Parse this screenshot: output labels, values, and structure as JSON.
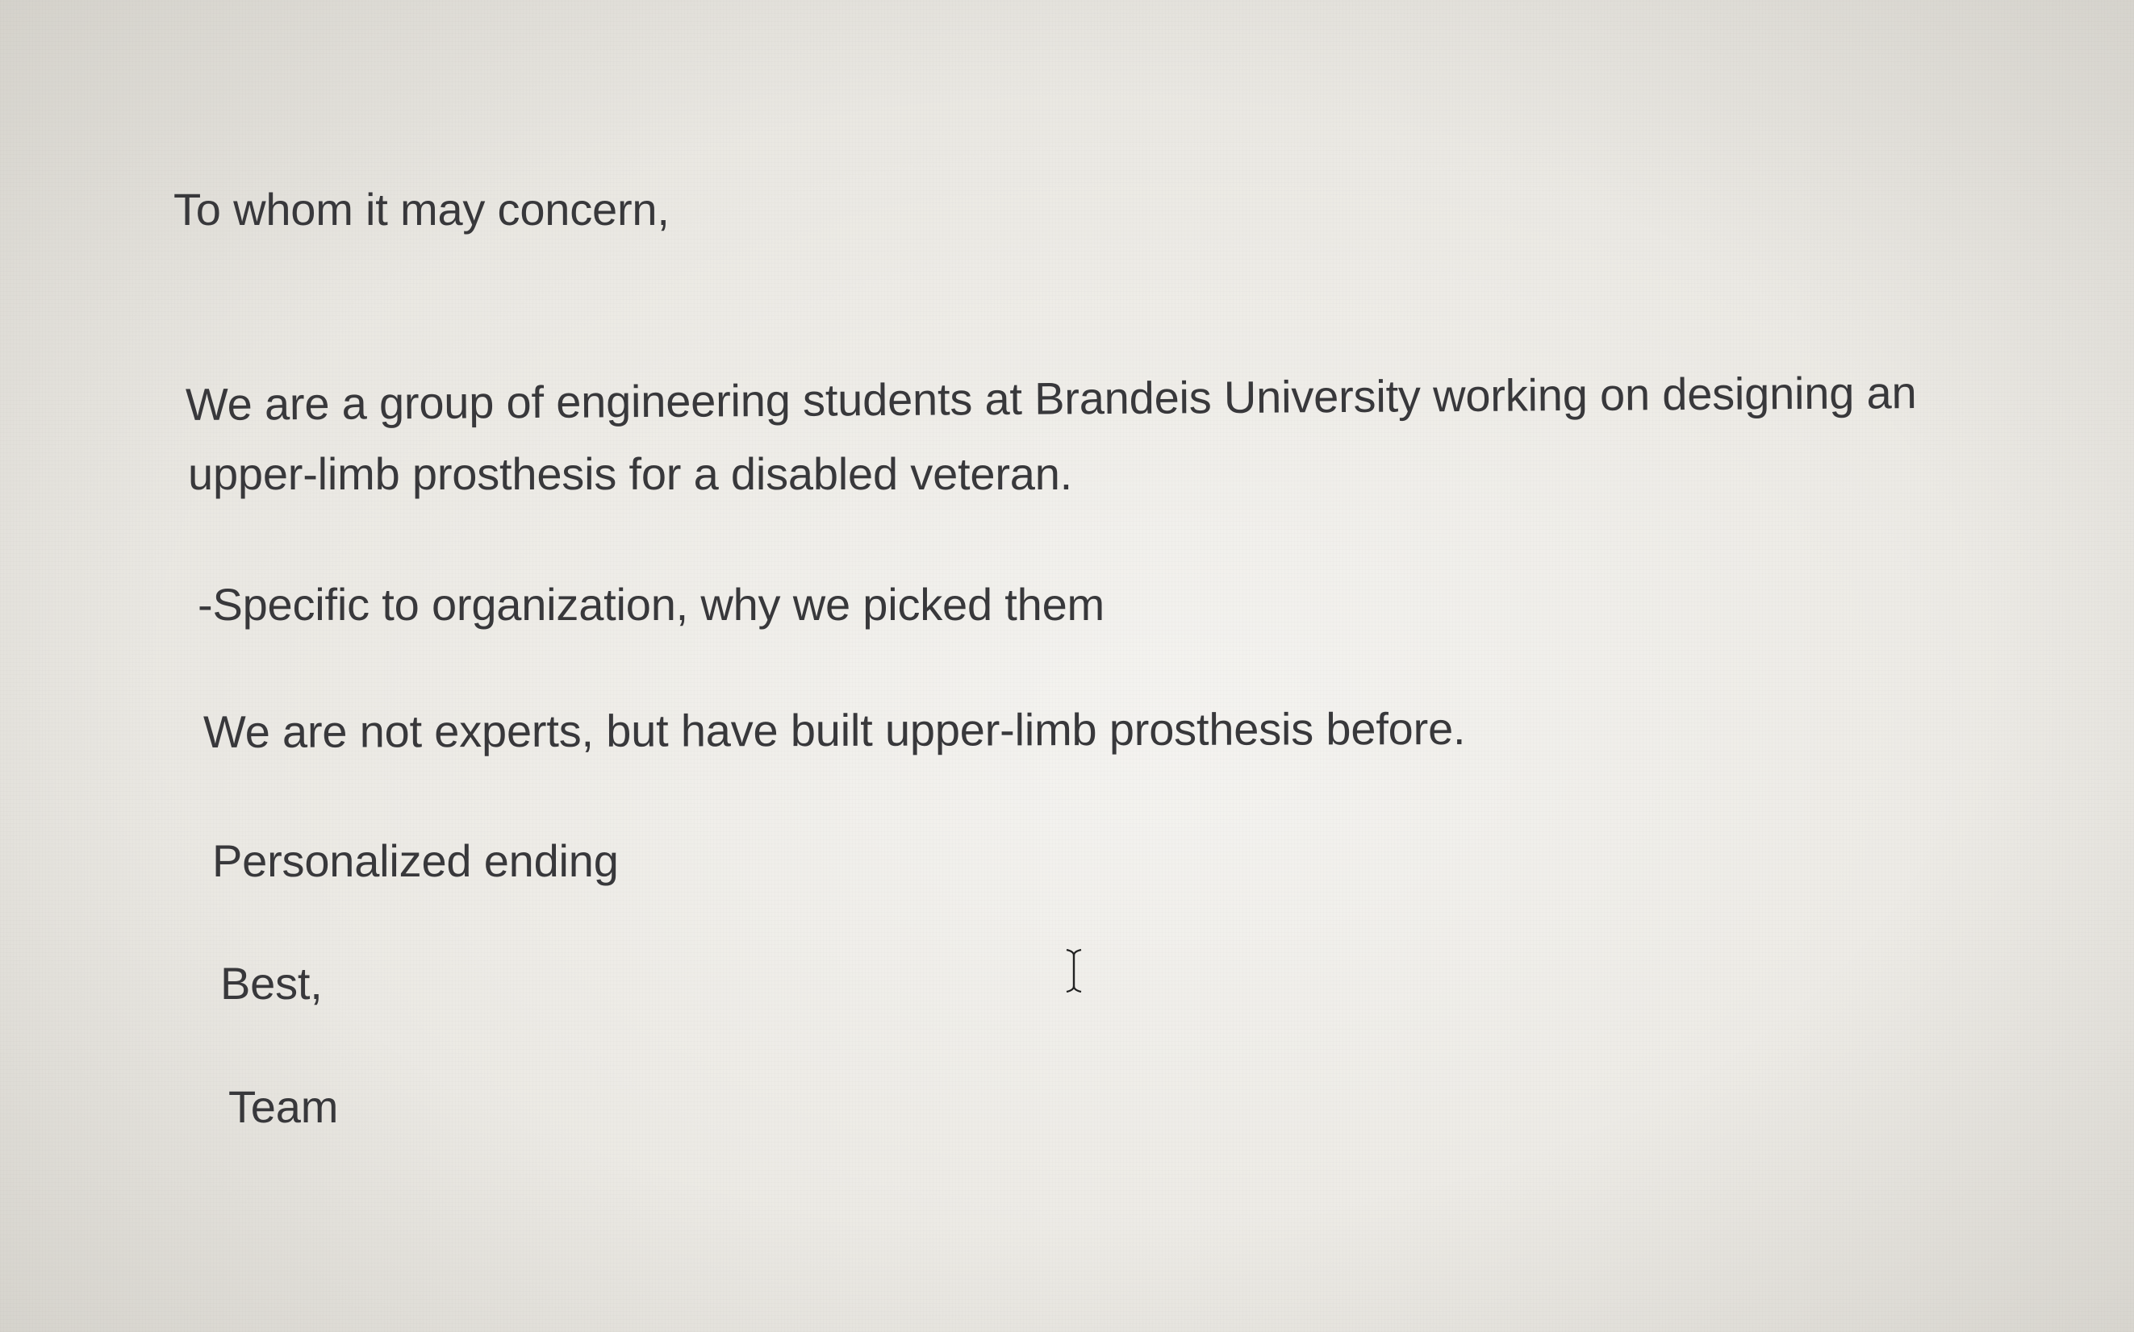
{
  "document": {
    "salutation": "To whom it may concern,",
    "paragraph_1_line_1": "We are a group of engineering students at Brandeis University working on designing an",
    "paragraph_1_line_2": "upper-limb prosthesis for a disabled veteran.",
    "bullet_note": "-Specific to organization, why we picked them",
    "paragraph_2": "We are not experts, but have built upper-limb prosthesis before.",
    "ending_note": "Personalized ending",
    "closing": "Best,",
    "signature": "Team"
  },
  "cursor": {
    "icon": "text-cursor-icon"
  },
  "colors": {
    "page_background": "#efeeea",
    "text": "#38383b"
  }
}
